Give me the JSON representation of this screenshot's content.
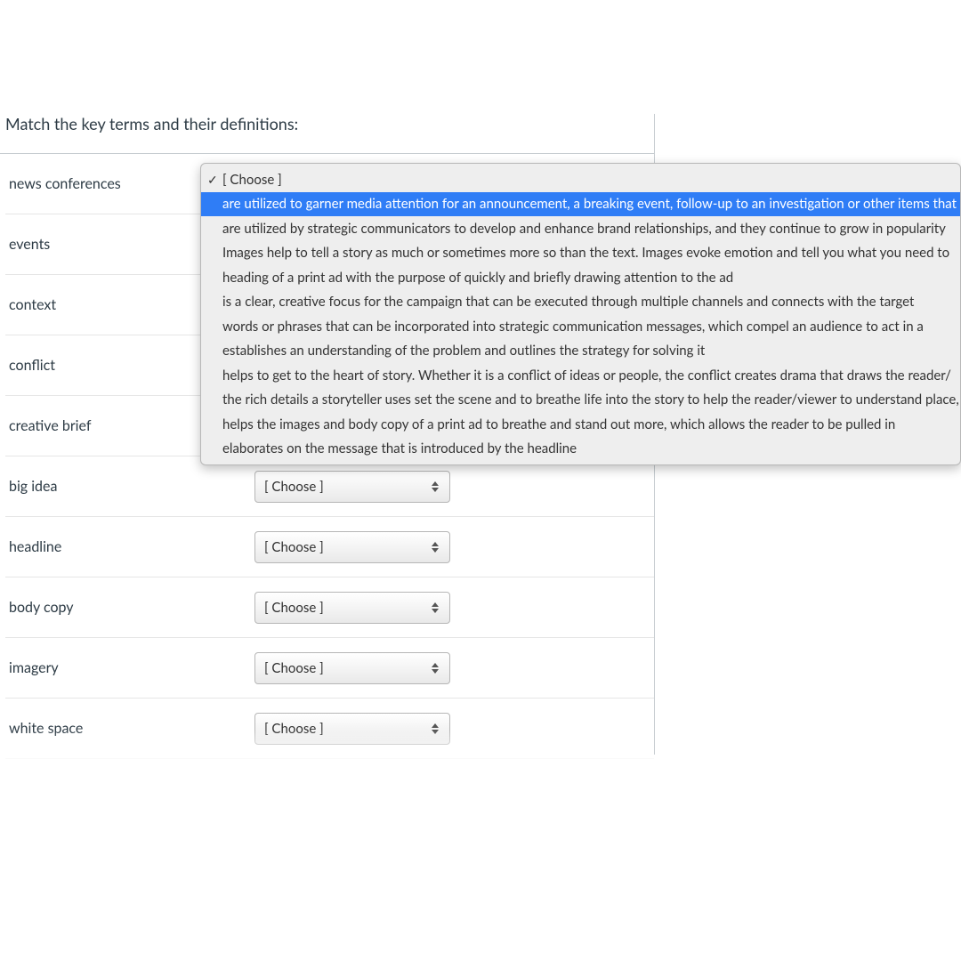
{
  "question": {
    "title": "Match the key terms and their definitions:"
  },
  "terms": [
    "news conferences",
    "events",
    "context",
    "conflict",
    "creative brief",
    "big idea",
    "headline",
    "body copy",
    "imagery",
    "white space"
  ],
  "choosePlaceholder": "[ Choose ]",
  "dropdown": {
    "checkedIndex": 0,
    "selectedIndex": 1,
    "options": [
      "[ Choose ]",
      "are utilized to garner media attention for an announcement, a breaking event, follow-up to an investigation or other items that",
      "are utilized by strategic communicators to develop and enhance brand relationships, and they continue to grow in popularity",
      "Images help to tell a story as much or sometimes more so than the text. Images evoke emotion and tell you what you need to",
      "heading of a print ad with the purpose of quickly and briefly drawing attention to the ad",
      "is a clear, creative focus for the campaign that can be executed through multiple channels and connects with the target",
      "words or phrases that can be incorporated into strategic communication messages, which compel an audience to act in a",
      "establishes an understanding of the problem and outlines the strategy for solving it",
      "helps to get to the heart of story. Whether it is a conflict of ideas or people, the conflict creates drama that draws the reader/",
      "the rich details a storyteller uses set the scene and to breathe life into the story to help the reader/viewer to understand place,",
      "helps the images and body copy of a print ad to breathe and stand out more, which allows the reader to be pulled in",
      "elaborates on the message that is introduced by the headline"
    ]
  }
}
